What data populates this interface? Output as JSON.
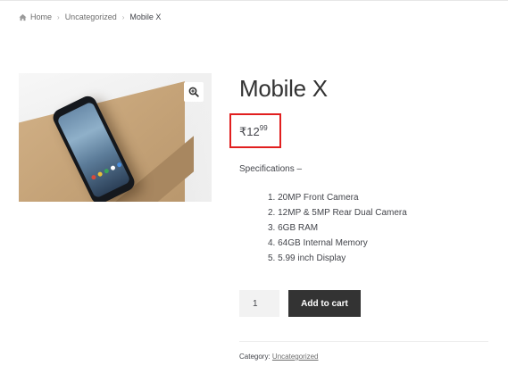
{
  "breadcrumb": {
    "home_icon": "home-icon",
    "home": "Home",
    "category": "Uncategorized",
    "current": "Mobile X"
  },
  "product": {
    "title": "Mobile X",
    "price_symbol": "₹",
    "price_whole": "12",
    "price_fraction": "99",
    "spec_heading": "Specifications –",
    "specs": [
      "20MP Front Camera",
      "12MP & 5MP Rear Dual Camera",
      "6GB RAM",
      "64GB Internal Memory",
      "5.99 inch Display"
    ],
    "zoom_icon": "magnify-plus-icon"
  },
  "cart": {
    "quantity": "1",
    "add_label": "Add to cart"
  },
  "meta": {
    "category_label": "Category:",
    "category_value": "Uncategorized"
  },
  "colors": {
    "highlight": "#e11f1f",
    "button": "#333333"
  }
}
